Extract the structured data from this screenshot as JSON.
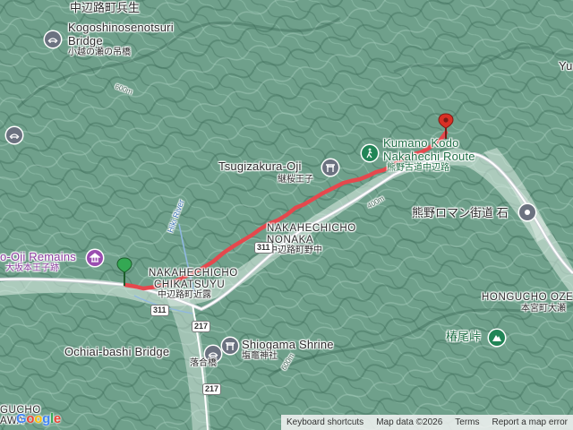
{
  "map": {
    "labels": {
      "top_jp": "中辺路町兵生",
      "kogoshi_en1": "Kogoshinosenotsuri",
      "kogoshi_en2": "Bridge",
      "kogoshi_jp": "小越の瀬の吊橋",
      "yu": "Yu",
      "kumano_en1": "Kumano Kodo",
      "kumano_en2": "Nakahechi Route",
      "kumano_jp": "熊野古道中辺路",
      "tsugizakura_en": "Tsugizakura-Oji",
      "tsugizakura_jp": "継桜王子",
      "romantic_jp": "熊野ロマン街道 石",
      "nonaka_en1": "NAKAHECHICHO",
      "nonaka_en2": "NONAKA",
      "nonaka_jp": "中辺路町野中",
      "oji_en": "o-Oji Remains",
      "oji_jp": "大坂本王子跡",
      "chikatsuyu_en1": "NAKAHECHICHO",
      "chikatsuyu_en2": "CHIKATSUYU",
      "chikatsuyu_jp": "中辺路町近露",
      "hongu_en": "HONGUCHO OZE",
      "hongu_jp": "本宮町大瀬",
      "shiogama_en": "Shiogama Shrine",
      "shiogama_jp": "塩竈神社",
      "ochiai_en": "Ochiai-bashi Bridge",
      "ochiai_jp": "落合橋",
      "tsubao_jp": "椿尾峠",
      "river": "Hiki River",
      "bottom_left": "GUCHO",
      "bottom_left2": "AWA",
      "route_311a": "311",
      "route_311b": "311",
      "route_217a": "217",
      "route_217b": "217",
      "elev_600_a": "600m",
      "elev_600_b": "600m",
      "elev_400": "400m"
    },
    "icons": {
      "bridge": "bridge-icon",
      "torii": "torii-icon",
      "hiking": "hiking-icon",
      "monument": "monument-icon",
      "mountain": "mountain-icon",
      "start_marker": "start-flag-icon",
      "end_marker": "end-pin-icon"
    },
    "colors": {
      "route": "#e5484d",
      "start": "#34a853",
      "end": "#d93025",
      "purple_poi": "#9a4db0",
      "green_poi": "#218556"
    }
  },
  "attribution": {
    "shortcuts": "Keyboard shortcuts",
    "map_data": "Map data ©2026",
    "terms": "Terms",
    "report": "Report a map error"
  },
  "logo": {
    "g1": "G",
    "g2": "o",
    "g3": "o",
    "g4": "g",
    "g5": "l",
    "g6": "e"
  }
}
